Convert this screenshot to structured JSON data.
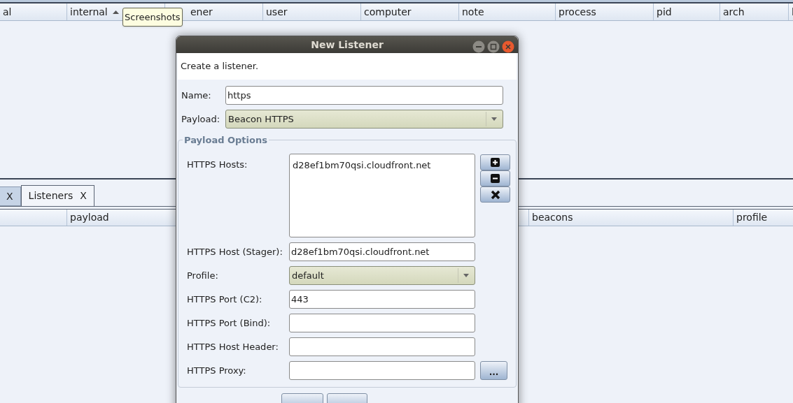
{
  "top_table": {
    "columns": [
      {
        "label": "al",
        "sorted": false
      },
      {
        "label": "internal",
        "sorted": true
      },
      {
        "label": "ener",
        "sorted": false
      },
      {
        "label": "user",
        "sorted": false
      },
      {
        "label": "computer",
        "sorted": false
      },
      {
        "label": "note",
        "sorted": false
      },
      {
        "label": "process",
        "sorted": false
      },
      {
        "label": "pid",
        "sorted": false
      },
      {
        "label": "arch",
        "sorted": false
      },
      {
        "label": "l"
      }
    ]
  },
  "tooltip": "Screenshots",
  "tabs": [
    {
      "close": "X",
      "selected": false
    },
    {
      "label": "Listeners",
      "close": "X",
      "selected": true
    }
  ],
  "bottom_table": {
    "columns": [
      {
        "label": "payload"
      },
      {
        "label": "beacons"
      },
      {
        "label": "profile"
      }
    ]
  },
  "dialog": {
    "title": "New Listener",
    "description": "Create a listener.",
    "name": {
      "label": "Name:",
      "value": "https"
    },
    "payload": {
      "label": "Payload:",
      "value": "Beacon HTTPS"
    },
    "group_title": "Payload Options",
    "options": [
      {
        "kind": "list",
        "label": "HTTPS Hosts:",
        "items": [
          "d28ef1bm70qsi.cloudfront.net"
        ]
      },
      {
        "kind": "text",
        "label": "HTTPS Host (Stager):",
        "value": "d28ef1bm70qsi.cloudfront.net"
      },
      {
        "kind": "select",
        "label": "Profile:",
        "value": "default"
      },
      {
        "kind": "text",
        "label": "HTTPS Port (C2):",
        "value": "443"
      },
      {
        "kind": "text",
        "label": "HTTPS Port (Bind):"
      },
      {
        "kind": "text",
        "label": "HTTPS Host Header:"
      },
      {
        "kind": "browse",
        "label": "HTTPS Proxy:",
        "button": "..."
      }
    ]
  }
}
